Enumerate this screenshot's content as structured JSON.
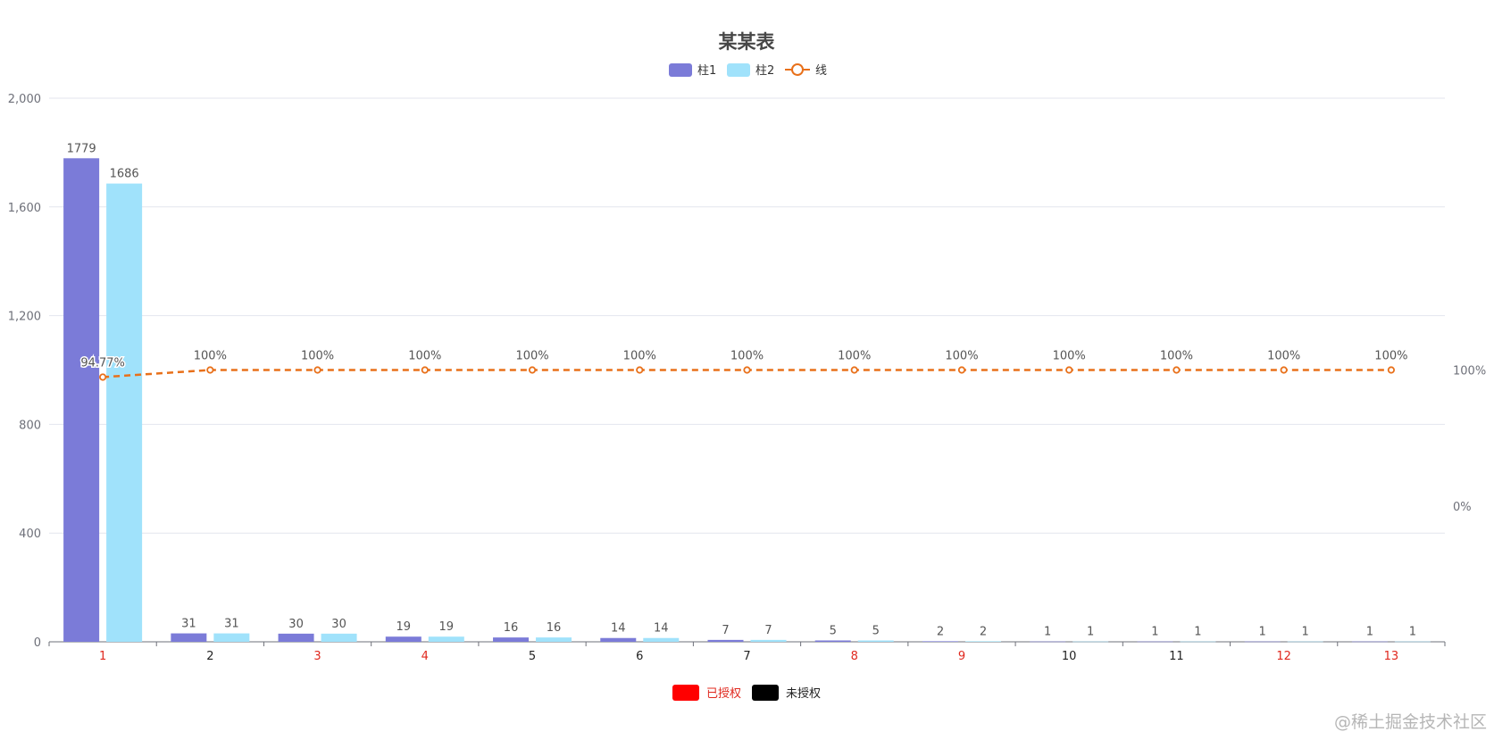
{
  "chart_data": {
    "type": "bar",
    "title": "某某表",
    "categories": [
      "1",
      "2",
      "3",
      "4",
      "5",
      "6",
      "7",
      "8",
      "9",
      "10",
      "11",
      "12",
      "13"
    ],
    "category_status": [
      "已授权",
      "未授权",
      "已授权",
      "已授权",
      "未授权",
      "未授权",
      "未授权",
      "已授权",
      "已授权",
      "未授权",
      "未授权",
      "已授权",
      "已授权"
    ],
    "series": [
      {
        "name": "柱1",
        "type": "bar",
        "color": "#7b7bd8",
        "values": [
          1779,
          31,
          30,
          19,
          16,
          14,
          7,
          5,
          2,
          1,
          1,
          1,
          1
        ]
      },
      {
        "name": "柱2",
        "type": "bar",
        "color": "#a0e2fb",
        "values": [
          1686,
          31,
          30,
          19,
          16,
          14,
          7,
          5,
          2,
          1,
          1,
          1,
          1
        ]
      },
      {
        "name": "线",
        "type": "line",
        "color": "#e8701a",
        "axis": "right",
        "values": [
          94.77,
          100,
          100,
          100,
          100,
          100,
          100,
          100,
          100,
          100,
          100,
          100,
          100
        ],
        "labels": [
          "94.77%",
          "100%",
          "100%",
          "100%",
          "100%",
          "100%",
          "100%",
          "100%",
          "100%",
          "100%",
          "100%",
          "100%",
          "100%"
        ]
      }
    ],
    "y_left": {
      "ylim": [
        0,
        2000
      ],
      "ticks": [
        0,
        400,
        800,
        1200,
        1600,
        2000
      ],
      "tick_labels": [
        "0",
        "400",
        "800",
        "1,200",
        "1,600",
        "2,000"
      ]
    },
    "y_right": {
      "ylim": [
        -100,
        300
      ],
      "ticks": [
        0,
        100
      ],
      "tick_labels": [
        "0%",
        "100%"
      ]
    },
    "grid": true,
    "legend_position": "top-center",
    "status_legend": [
      {
        "label": "已授权",
        "color": "#ff0000",
        "text_color": "#e0281e"
      },
      {
        "label": "未授权",
        "color": "#000000",
        "text_color": "#222222"
      }
    ]
  },
  "watermark": "@稀土掘金技术社区"
}
